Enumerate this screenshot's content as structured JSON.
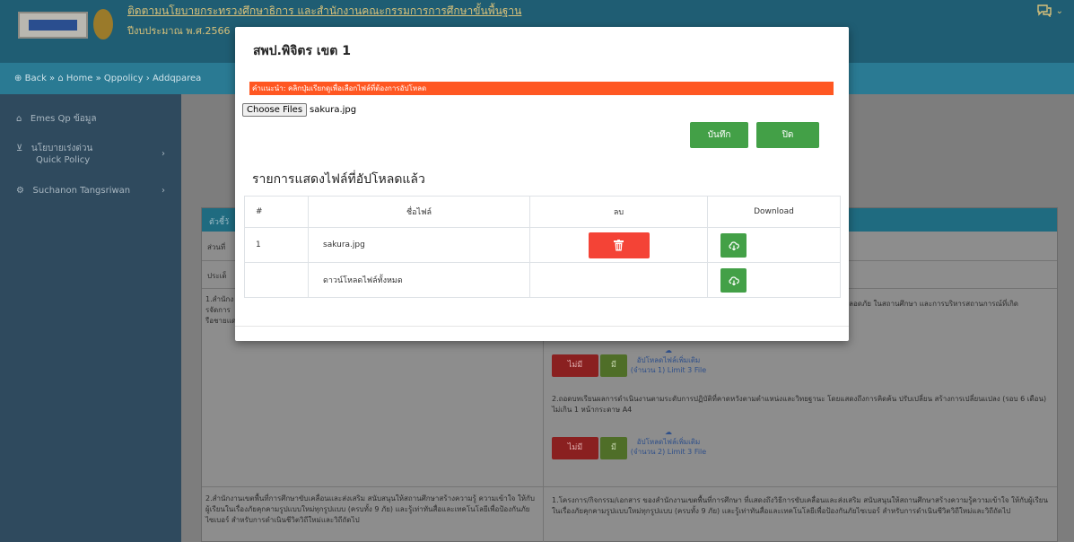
{
  "header": {
    "site_title": "ติดตามนโยบายกระทรวงศึกษาธิการ และสำนักงานคณะกรรมการการศึกษาขั้นพื้นฐาน",
    "site_subtitle": "ปีงบประมาณ พ.ศ.2566",
    "chat_icon": "chat-icon",
    "chat_chevron": "⌄"
  },
  "breadcrumb": {
    "back": "Back",
    "home": "Home",
    "qppolicy": "Qppolicy",
    "current": "Addqparea"
  },
  "sidebar": {
    "items": [
      {
        "label": "Emes Qp ข้อมูล",
        "icon": "home-icon"
      },
      {
        "label": "นโยบายเร่งด่วน",
        "sub": "Quick Policy",
        "icon": "gift-icon"
      },
      {
        "label": "Suchanon Tangsriwan",
        "icon": "gear-icon"
      }
    ]
  },
  "background_table": {
    "header_label": "ตัวชี้วั",
    "row1": "ส่วนที่",
    "row2": "ประเด็",
    "row3_left": "1.สำนักง\nรจัดการ\nรือชายแดนแบะบนแแ",
    "row3_right_tail": "ปลอดภัย ในสถานศึกษา และการบริหารสถานการณ์ที่เกิด",
    "btn_no": "ไม่มี",
    "btn_yes": "มี",
    "upload_more_1": "อัปโหลดไฟล์เพิ่มเติม",
    "upload_limit_1": "(จำนวน 1) Limit 3 File",
    "item2": "2.ถอดบทเรียนผลการดำเนินงานตามระดับการปฏิบัติที่คาดหวังตามตำแหน่งและวิทยฐานะ โดยแสดงถึงการคิดค้น ปรับเปลี่ยน สร้างการเปลี่ยนแปลง (รอบ 6 เดือน) ไม่เกิน 1 หน้ากระดาษ A4",
    "upload_more_2": "อัปโหลดไฟล์เพิ่มเติม",
    "upload_limit_2": "(จำนวน 2) Limit 3 File",
    "row4_left": "2.สำนักงานเขตพื้นที่การศึกษาขับเคลื่อนและส่งเสริม สนับสนุนให้สถานศึกษาสร้างความรู้ ความเข้าใจ ให้กับผู้เรียนในเรื่องภัยคุกคามรูปแบบใหม่ทุกรูปแบบ (ครบทั้ง 9 ภัย) และรู้เท่าทันสื่อและเทคโนโลยีเพื่อป้องกันภัยไซเบอร์ สำหรับการดำเนินชีวิตวิถีใหม่และวิถีถัดไป",
    "row4_right": "1.โครงการ/กิจกรรม/เอกสาร ของสำนักงานเขตพื้นที่การศึกษา ที่แสดงถึงวิธีการขับเคลื่อนและส่งเสริม สนับสนุนให้สถานศึกษาสร้างความรู้ความเข้าใจ ให้กับผู้เรียนในเรื่องภัยคุกคามรูปแบบใหม่ทุกรูปแบบ (ครบทั้ง 9 ภัย) และรู้เท่าทันสื่อและเทคโนโลยีเพื่อป้องกันภัยไซเบอร์ สำหรับการดำเนินชีวิตวิถีใหม่และวิถีถัดไป"
  },
  "modal": {
    "title": "สพป.พิจิตร เขต 1",
    "notice": "คำแนะนำ: คลิกปุ่มเรียกดูเพื่อเลือกไฟล์ที่ต้องการอัปโหลด",
    "choose_files_label": "Choose Files",
    "selected_file": "sakura.jpg",
    "save_label": "บันทึก",
    "close_label": "ปิด",
    "list_heading": "รายการแสดงไฟล์ที่อัปโหลดแล้ว",
    "table": {
      "headers": [
        "#",
        "ชื่อไฟล์",
        "ลบ",
        "Download"
      ],
      "rows": [
        {
          "num": "1",
          "name": "sakura.jpg"
        },
        {
          "num": "",
          "name": "ดาวน์โหลดไฟล์ทั้งหมด"
        }
      ]
    }
  },
  "colors": {
    "topbar": "#1f5d73",
    "notice": "#ff5722",
    "success": "#43a047",
    "danger": "#f44336"
  }
}
